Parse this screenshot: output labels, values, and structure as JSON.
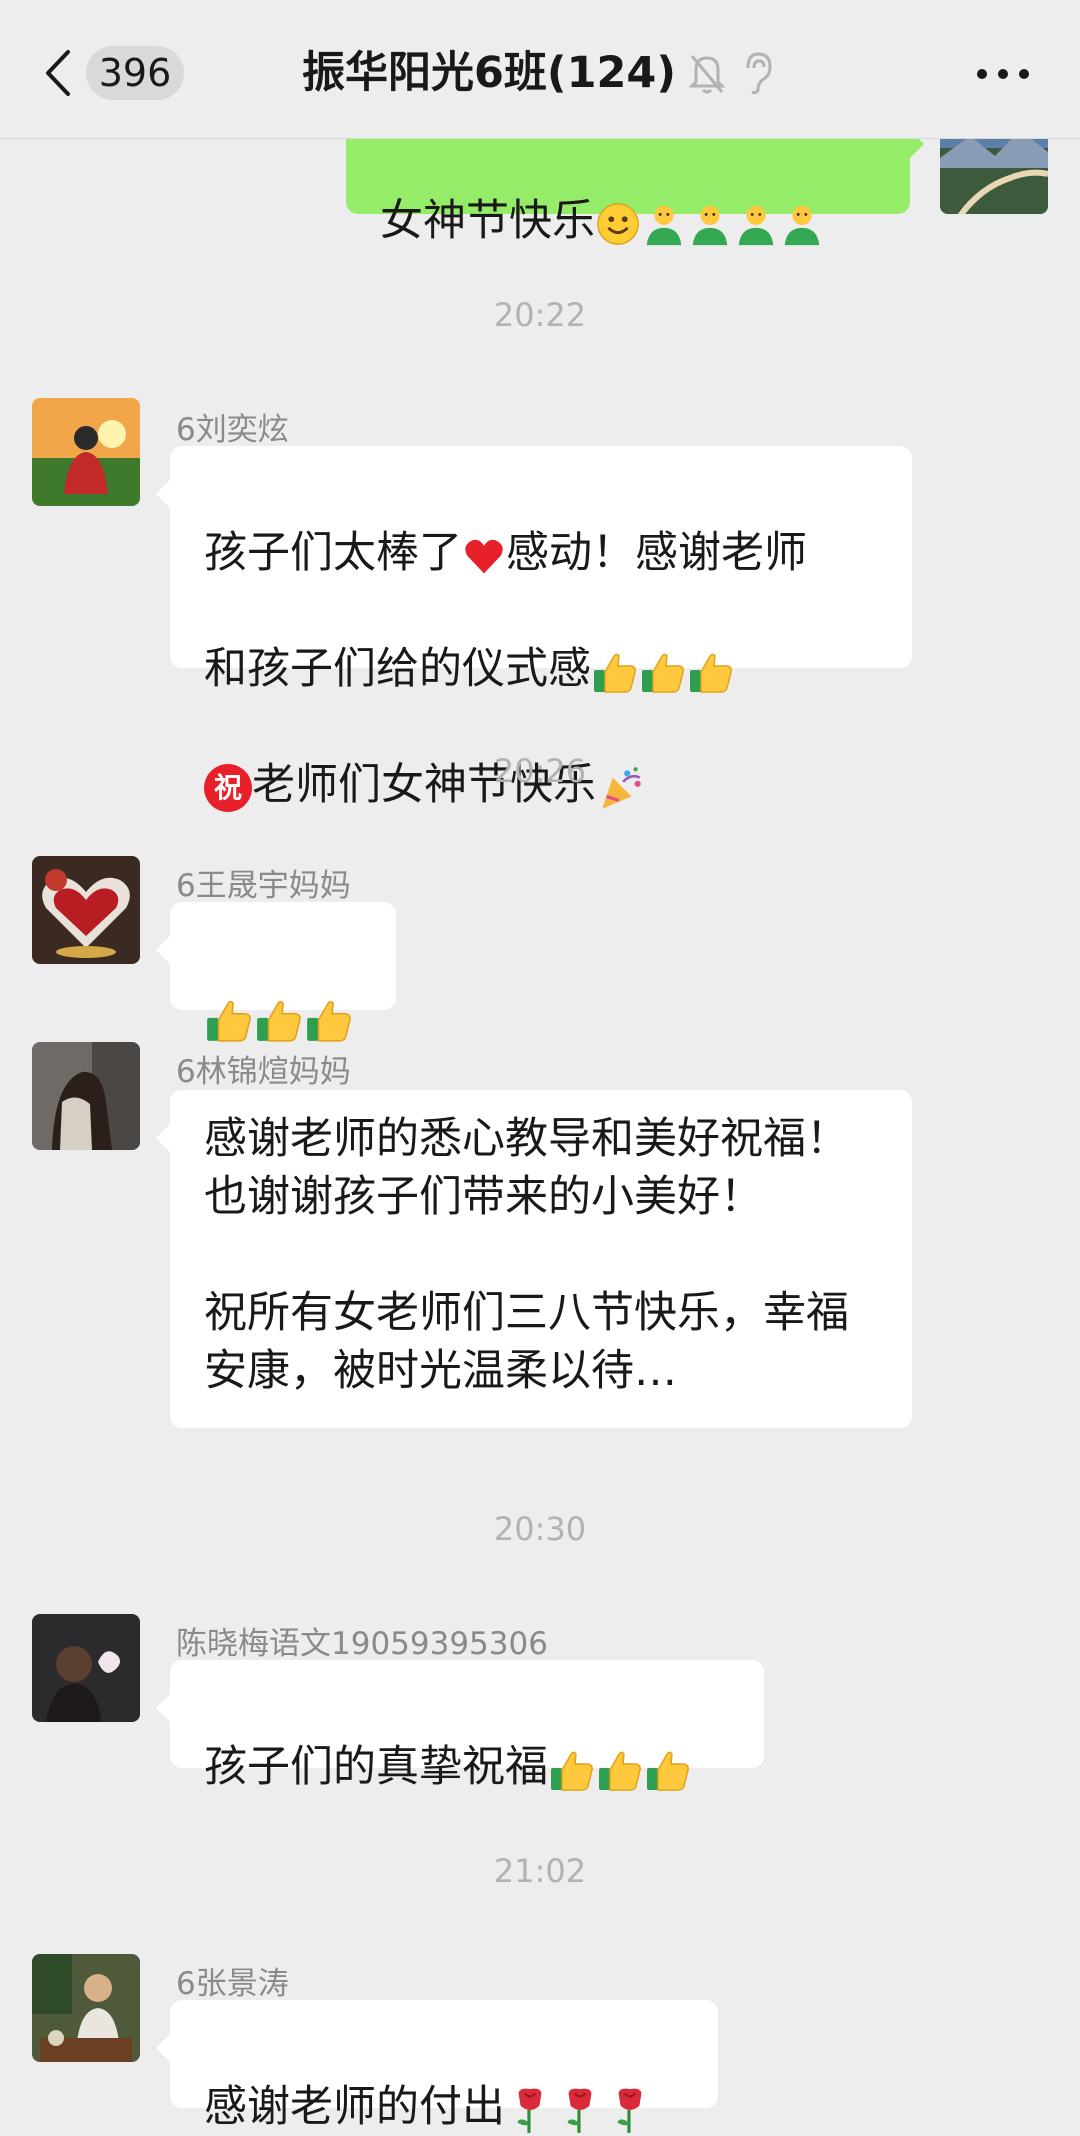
{
  "header": {
    "unread_count": "396",
    "title": "振华阳光6班(124)"
  },
  "messages": {
    "m0": {
      "text": "女神节快乐",
      "side": "out"
    },
    "t1": "20:22",
    "m1": {
      "sender": "6刘奕炫",
      "line1": "孩子们太棒了",
      "line1b": "感动！感谢老师",
      "line2": "和孩子们给的仪式感",
      "line3": "老师们女神节快乐",
      "badge": "祝"
    },
    "t2": "20:26",
    "m2": {
      "sender": "6王晟宇妈妈"
    },
    "m3": {
      "sender": "6林锦煊妈妈",
      "text": "感谢老师的悉心教导和美好祝福！\n也谢谢孩子们带来的小美好！\n\n祝所有女老师们三八节快乐，幸福\n安康，被时光温柔以待…"
    },
    "t3": "20:30",
    "m4": {
      "sender": "陈晓梅语文19059395306",
      "text": "孩子们的真挚祝福"
    },
    "t4": "21:02",
    "m5": {
      "sender": "6张景涛",
      "text": "感谢老师的付出"
    }
  },
  "colors": {
    "outgoing": "#95ec69",
    "incoming": "#ffffff",
    "background": "#ededed"
  },
  "icons": [
    "back-icon",
    "mute-icon",
    "ear-icon",
    "more-icon",
    "smile-emoji",
    "bust-emoji",
    "heart-emoji",
    "thumbs-up-emoji",
    "party-emoji",
    "rose-emoji"
  ]
}
